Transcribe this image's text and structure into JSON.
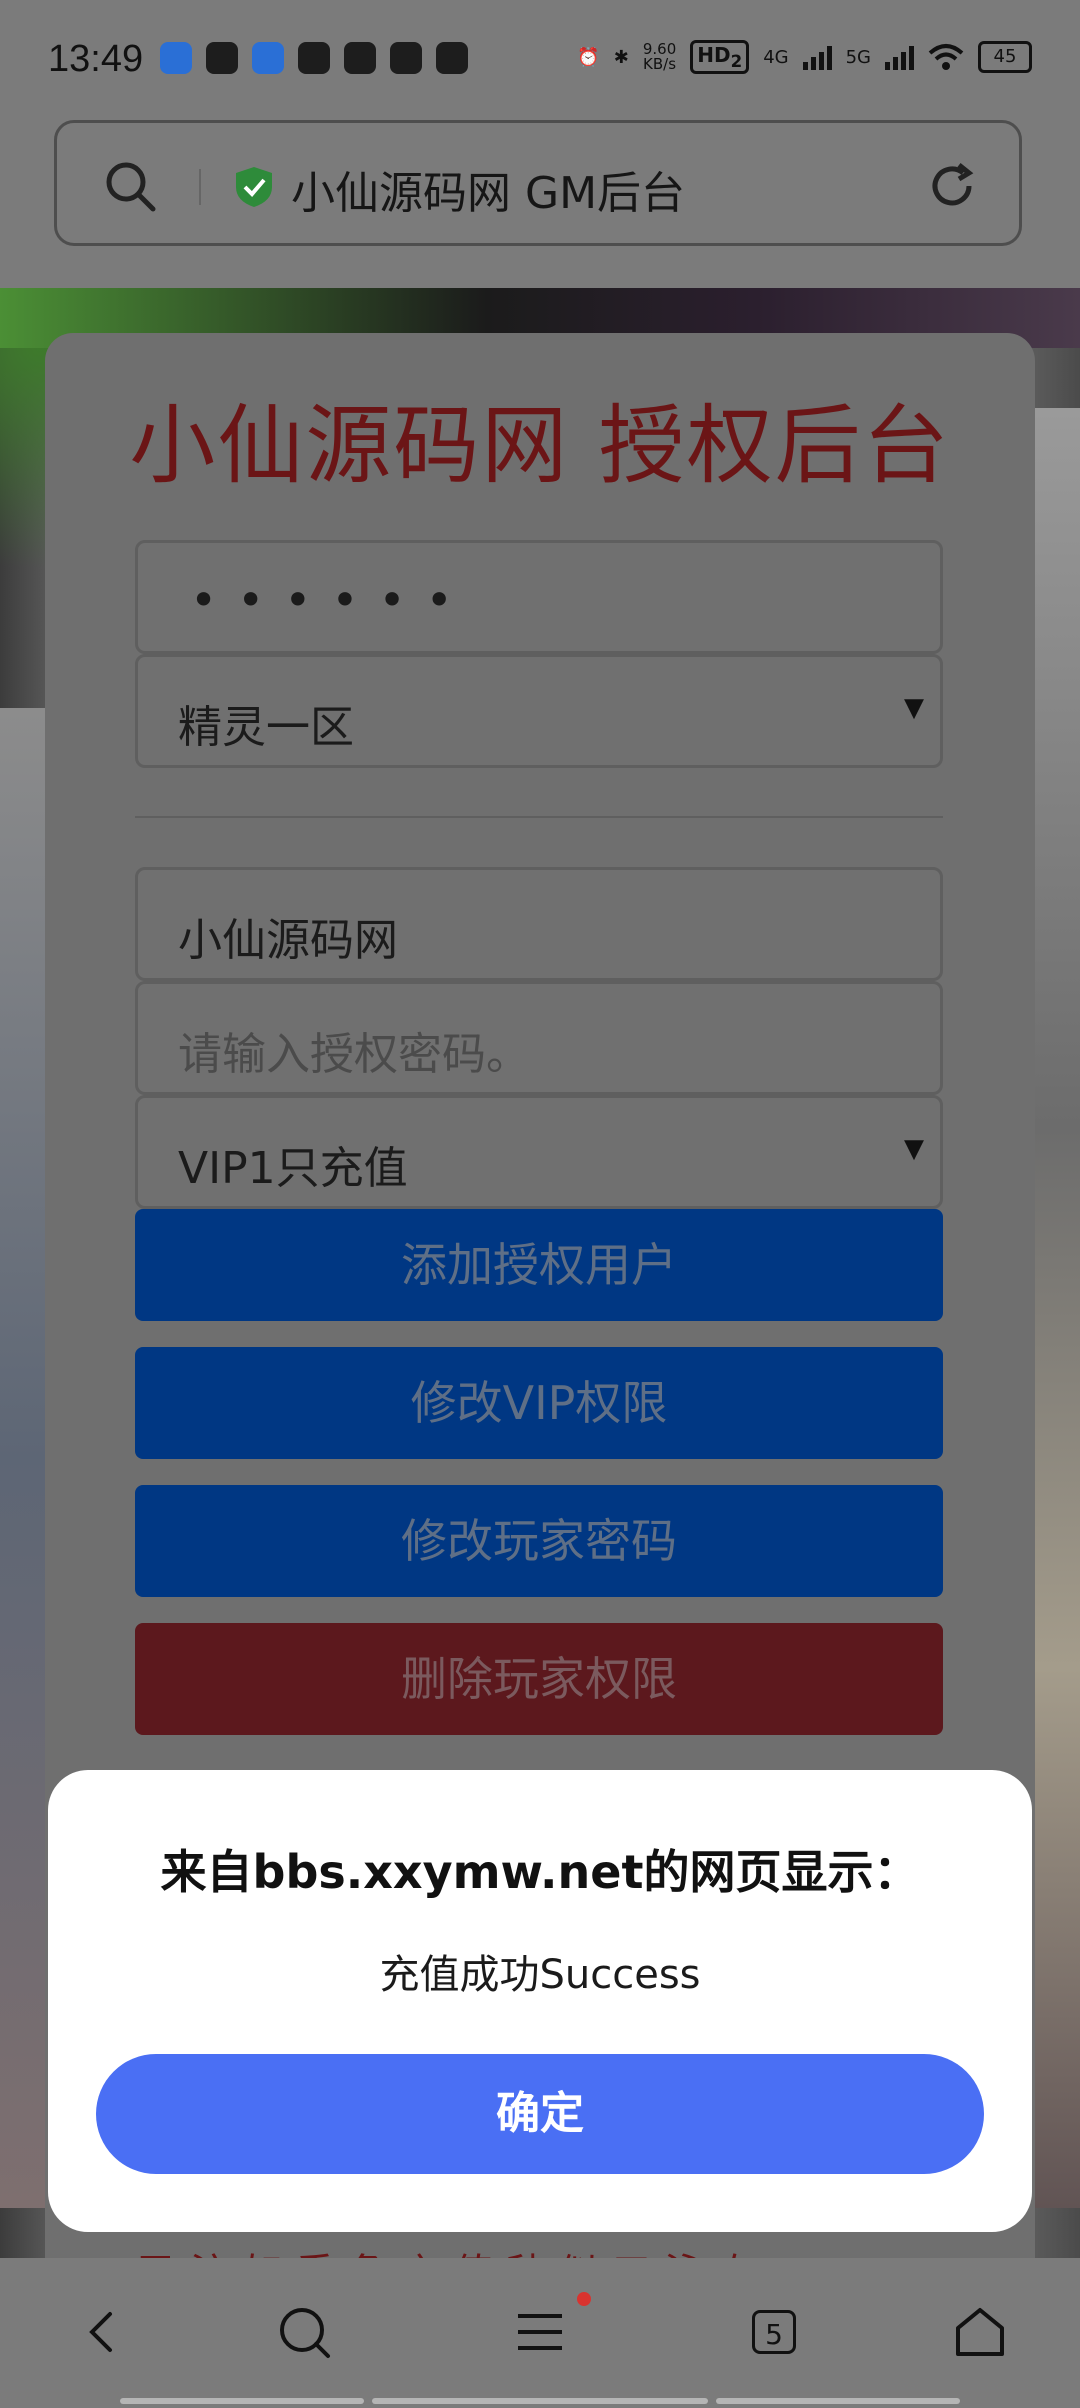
{
  "status_bar": {
    "time": "13:49",
    "net_speed_value": "9.60",
    "net_speed_unit": "KB/s",
    "hd_label": "HD",
    "hd_sub": "2",
    "signal_1": "4G",
    "signal_2": "5G",
    "battery": "45"
  },
  "browser": {
    "address_title": "小仙源码网 GM后台"
  },
  "card": {
    "title": "小仙源码网 授权后台",
    "password_mask": "••••••",
    "server_select": "精灵一区",
    "account_value": "小仙源码网",
    "auth_password_placeholder": "请输入授权密码。",
    "vip_select": "VIP1只充值",
    "buttons": {
      "add_user": "添加授权用户",
      "modify_vip": "修改VIP权限",
      "modify_password": "修改玩家密码",
      "delete_permission": "删除玩家权限"
    },
    "footer_partial": "已    注 如 乘 角 之 值 秒 似 三 泳    右"
  },
  "dialog": {
    "title": "来自bbs.xxymw.net的网页显示：",
    "message": "充值成功Success",
    "ok_label": "确定"
  },
  "bottom_nav": {
    "tabs_count": "5"
  },
  "colors": {
    "dialog_button": "#4a6ff4",
    "primary_button": "#003783",
    "danger_button": "#5c181d",
    "title_red": "#6b1516"
  }
}
